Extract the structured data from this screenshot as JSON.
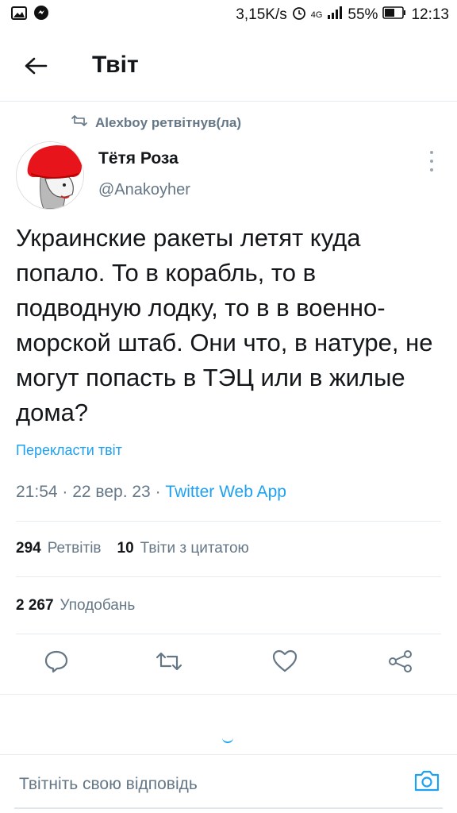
{
  "status_bar": {
    "speed": "3,15K/s",
    "network": "4G",
    "battery": "55%",
    "time": "12:13",
    "icons": [
      "image-icon",
      "messenger-icon",
      "alarm-icon",
      "signal-icon",
      "battery-icon"
    ]
  },
  "header": {
    "title": "Твіт"
  },
  "retweet": {
    "text": "Alexboy ретвітнув(ла)"
  },
  "author": {
    "name": "Тётя Роза",
    "handle": "@Anakoyher"
  },
  "tweet": {
    "text": "Украинские ракеты летят куда попало. То в корабль, то в подводную лодку, то в в военно-морской штаб. Они что, в натуре, не могут попасть в ТЭЦ или в жилые дома?",
    "translate": "Перекласти твіт",
    "time": "21:54",
    "date": "22 вер. 23",
    "app": "Twitter Web App"
  },
  "stats": {
    "retweets_count": "294",
    "retweets_label": "Ретвітів",
    "quotes_count": "10",
    "quotes_label": "Твіти з цитатою",
    "likes_count": "2 267",
    "likes_label": "Уподобань"
  },
  "reply": {
    "placeholder": "Твітніть свою відповідь"
  },
  "colors": {
    "accent": "#1da1f2",
    "secondary_text": "#657786",
    "primary_text": "#14171a"
  }
}
